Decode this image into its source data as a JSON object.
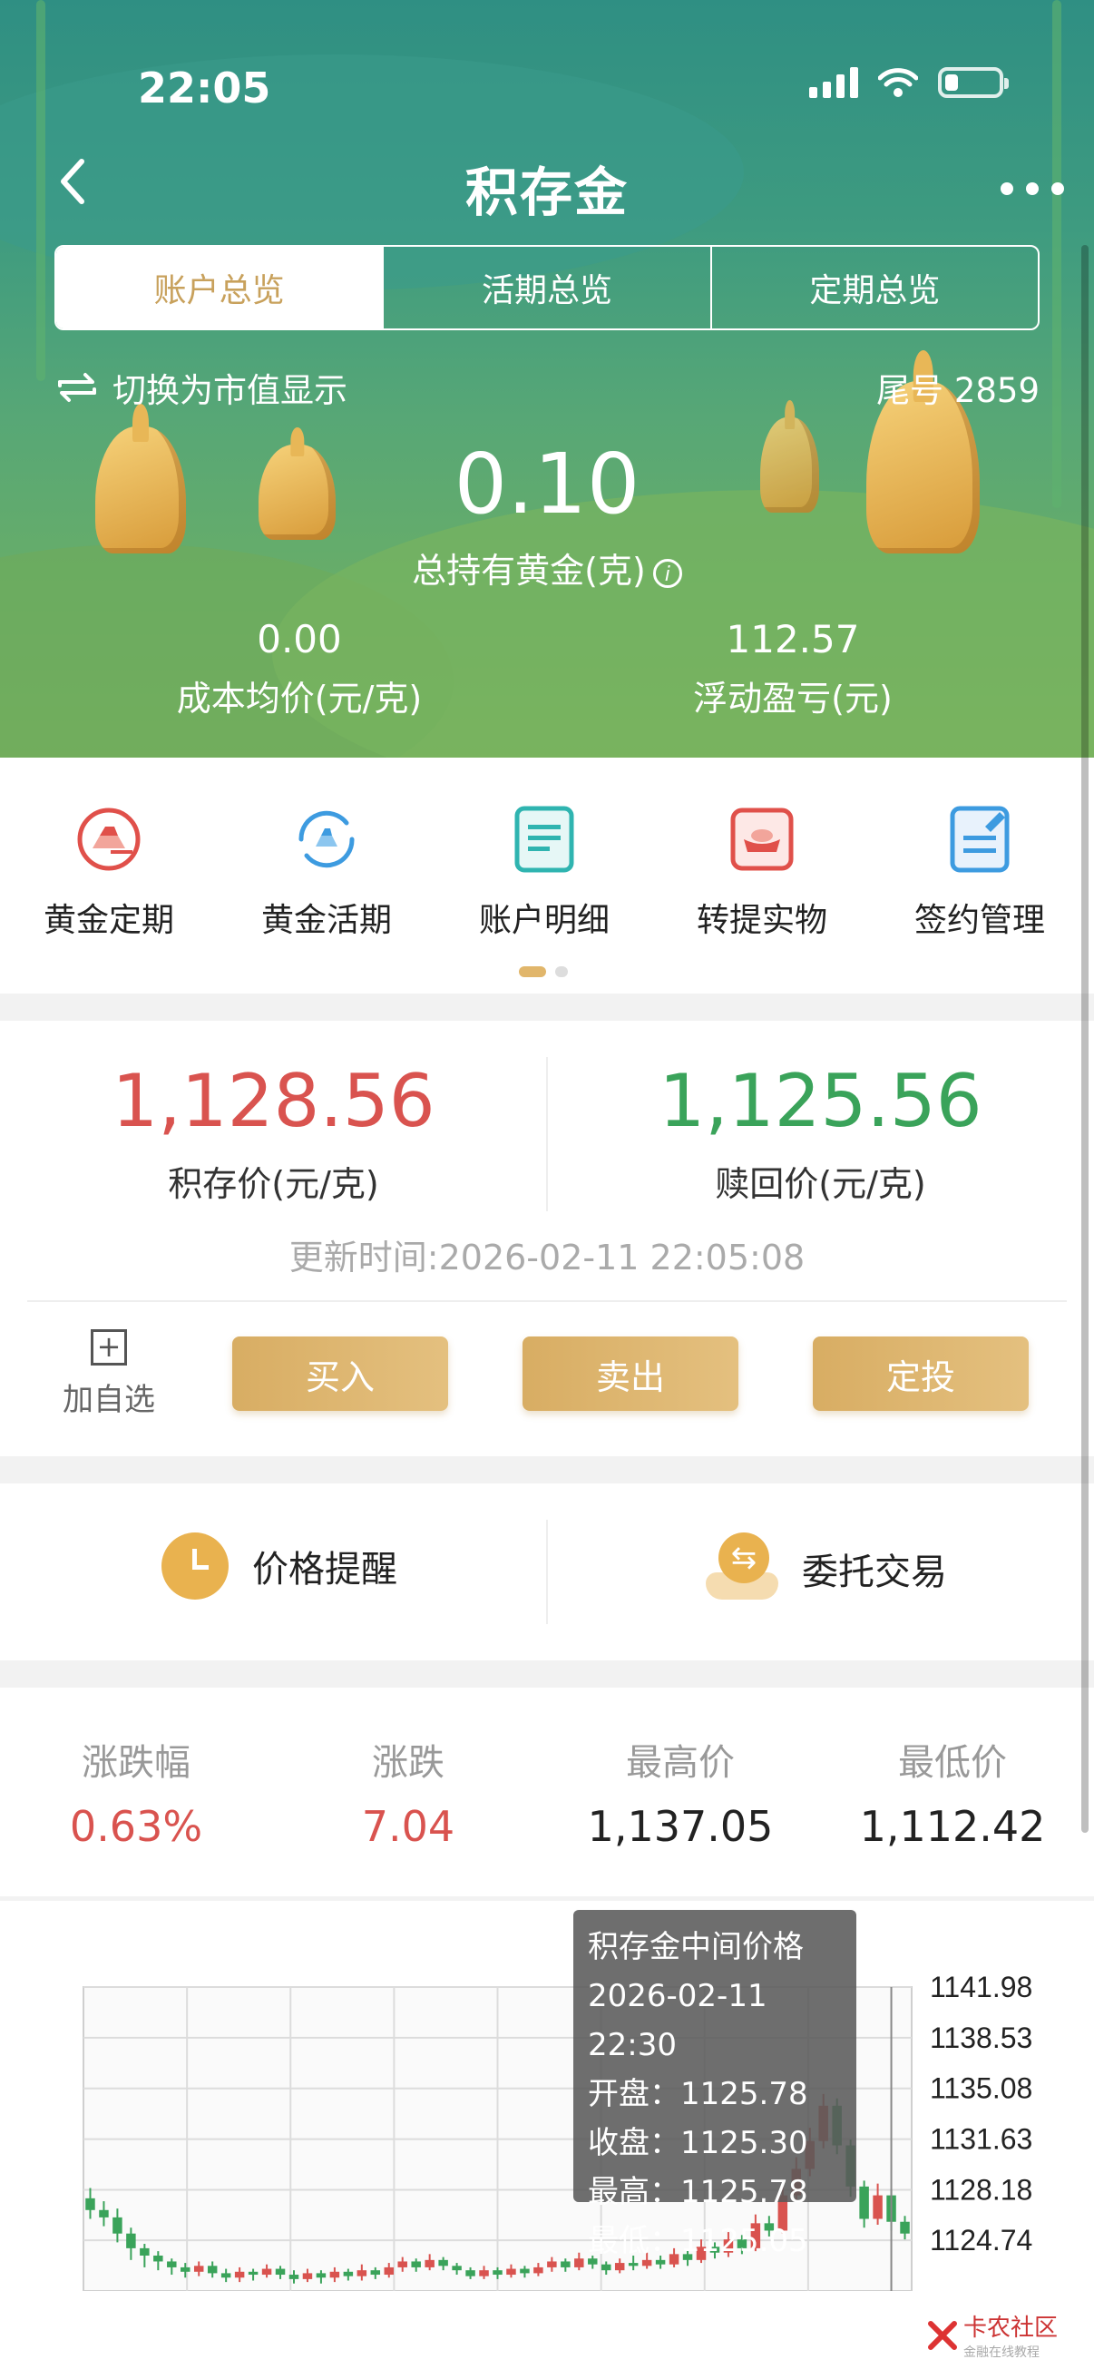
{
  "status": {
    "time": "22:05"
  },
  "nav": {
    "title": "积存金"
  },
  "tabs": [
    {
      "label": "账户总览",
      "active": true
    },
    {
      "label": "活期总览",
      "active": false
    },
    {
      "label": "定期总览",
      "active": false
    }
  ],
  "account": {
    "switch_label": "切换为市值显示",
    "tail_number": "尾号 2859",
    "total_gold": "0.10",
    "total_gold_label": "总持有黄金(克)",
    "avg_cost": "0.00",
    "avg_cost_label": "成本均价(元/克)",
    "float_pl": "112.57",
    "float_pl_label": "浮动盈亏(元)"
  },
  "quick_actions": [
    {
      "label": "黄金定期",
      "icon": "gold-bars-icon"
    },
    {
      "label": "黄金活期",
      "icon": "gold-refresh-icon"
    },
    {
      "label": "账户明细",
      "icon": "document-icon"
    },
    {
      "label": "转提实物",
      "icon": "ingot-icon"
    },
    {
      "label": "签约管理",
      "icon": "edit-document-icon"
    }
  ],
  "price": {
    "buy_price": "1,128.56",
    "buy_label": "积存价(元/克)",
    "redeem_price": "1,125.56",
    "redeem_label": "赎回价(元/克)",
    "update_time": "更新时间:2026-02-11 22:05:08",
    "add_fav": "加自选",
    "buy_btn": "买入",
    "sell_btn": "卖出",
    "plan_btn": "定投"
  },
  "tools": {
    "reminder": "价格提醒",
    "entrust": "委托交易"
  },
  "stats": [
    {
      "label": "涨跌幅",
      "value": "0.63%",
      "color": "#d9534f"
    },
    {
      "label": "涨跌",
      "value": "7.04",
      "color": "#d9534f"
    },
    {
      "label": "最高价",
      "value": "1,137.05",
      "color": "#222222"
    },
    {
      "label": "最低价",
      "value": "1,112.42",
      "color": "#222222"
    }
  ],
  "tooltip": {
    "title": "积存金中间价格",
    "time": "2026-02-11 22:30",
    "open": "开盘：1125.78",
    "close": "收盘：1125.30",
    "high": "最高：1125.78",
    "low": "最低：1125.05"
  },
  "watermark": {
    "text": "卡农社区",
    "sub": "金融在线教程"
  },
  "colors": {
    "up": "#d9534f",
    "down": "#3aa35a",
    "gold": "#d8ad63"
  },
  "chart_data": {
    "type": "candlestick",
    "y_ticks": [
      "1141.98",
      "1138.53",
      "1135.08",
      "1131.63",
      "1128.18",
      "1124.74"
    ],
    "ylim": [
      1121.29,
      1141.98
    ],
    "grid": true,
    "candles": [
      {
        "o": 1127.6,
        "c": 1126.8,
        "h": 1128.3,
        "l": 1126.2
      },
      {
        "o": 1126.8,
        "c": 1126.3,
        "h": 1127.4,
        "l": 1125.7
      },
      {
        "o": 1126.3,
        "c": 1125.2,
        "h": 1126.9,
        "l": 1124.6
      },
      {
        "o": 1125.2,
        "c": 1124.2,
        "h": 1125.6,
        "l": 1123.4
      },
      {
        "o": 1124.2,
        "c": 1123.7,
        "h": 1124.5,
        "l": 1122.9
      },
      {
        "o": 1123.7,
        "c": 1123.3,
        "h": 1124.0,
        "l": 1122.7
      },
      {
        "o": 1123.3,
        "c": 1122.9,
        "h": 1123.5,
        "l": 1122.4
      },
      {
        "o": 1122.9,
        "c": 1122.6,
        "h": 1123.2,
        "l": 1122.2
      },
      {
        "o": 1122.6,
        "c": 1123.0,
        "h": 1123.3,
        "l": 1122.3
      },
      {
        "o": 1123.0,
        "c": 1122.5,
        "h": 1123.3,
        "l": 1122.2
      },
      {
        "o": 1122.5,
        "c": 1122.2,
        "h": 1122.8,
        "l": 1121.9
      },
      {
        "o": 1122.2,
        "c": 1122.6,
        "h": 1122.9,
        "l": 1121.9
      },
      {
        "o": 1122.6,
        "c": 1122.4,
        "h": 1122.8,
        "l": 1122.0
      },
      {
        "o": 1122.4,
        "c": 1122.8,
        "h": 1123.1,
        "l": 1122.2
      },
      {
        "o": 1122.8,
        "c": 1122.4,
        "h": 1123.0,
        "l": 1122.1
      },
      {
        "o": 1122.4,
        "c": 1122.1,
        "h": 1122.7,
        "l": 1121.8
      },
      {
        "o": 1122.1,
        "c": 1122.5,
        "h": 1122.8,
        "l": 1121.9
      },
      {
        "o": 1122.5,
        "c": 1122.2,
        "h": 1122.7,
        "l": 1121.8
      },
      {
        "o": 1122.2,
        "c": 1122.6,
        "h": 1122.9,
        "l": 1121.9
      },
      {
        "o": 1122.6,
        "c": 1122.3,
        "h": 1122.8,
        "l": 1122.0
      },
      {
        "o": 1122.3,
        "c": 1122.7,
        "h": 1123.1,
        "l": 1122.0
      },
      {
        "o": 1122.7,
        "c": 1122.4,
        "h": 1122.9,
        "l": 1122.1
      },
      {
        "o": 1122.4,
        "c": 1122.9,
        "h": 1123.2,
        "l": 1122.2
      },
      {
        "o": 1122.9,
        "c": 1123.3,
        "h": 1123.6,
        "l": 1122.6
      },
      {
        "o": 1123.3,
        "c": 1122.9,
        "h": 1123.5,
        "l": 1122.6
      },
      {
        "o": 1122.9,
        "c": 1123.4,
        "h": 1123.8,
        "l": 1122.7
      },
      {
        "o": 1123.4,
        "c": 1123.0,
        "h": 1123.6,
        "l": 1122.7
      },
      {
        "o": 1123.0,
        "c": 1122.7,
        "h": 1123.2,
        "l": 1122.4
      },
      {
        "o": 1122.7,
        "c": 1122.3,
        "h": 1122.9,
        "l": 1122.1
      },
      {
        "o": 1122.3,
        "c": 1122.7,
        "h": 1123.0,
        "l": 1122.1
      },
      {
        "o": 1122.7,
        "c": 1122.4,
        "h": 1122.9,
        "l": 1122.1
      },
      {
        "o": 1122.4,
        "c": 1122.8,
        "h": 1123.1,
        "l": 1122.2
      },
      {
        "o": 1122.8,
        "c": 1122.5,
        "h": 1123.0,
        "l": 1122.2
      },
      {
        "o": 1122.5,
        "c": 1122.9,
        "h": 1123.2,
        "l": 1122.3
      },
      {
        "o": 1122.9,
        "c": 1123.3,
        "h": 1123.6,
        "l": 1122.6
      },
      {
        "o": 1123.3,
        "c": 1122.9,
        "h": 1123.5,
        "l": 1122.6
      },
      {
        "o": 1122.9,
        "c": 1123.5,
        "h": 1123.9,
        "l": 1122.7
      },
      {
        "o": 1123.5,
        "c": 1123.1,
        "h": 1123.7,
        "l": 1122.8
      },
      {
        "o": 1123.1,
        "c": 1122.7,
        "h": 1123.3,
        "l": 1122.4
      },
      {
        "o": 1122.7,
        "c": 1123.2,
        "h": 1123.5,
        "l": 1122.5
      },
      {
        "o": 1123.2,
        "c": 1123.0,
        "h": 1123.7,
        "l": 1122.7
      },
      {
        "o": 1123.0,
        "c": 1123.4,
        "h": 1123.9,
        "l": 1122.8
      },
      {
        "o": 1123.4,
        "c": 1123.1,
        "h": 1123.7,
        "l": 1122.8
      },
      {
        "o": 1123.1,
        "c": 1123.8,
        "h": 1124.2,
        "l": 1122.9
      },
      {
        "o": 1123.8,
        "c": 1123.4,
        "h": 1124.1,
        "l": 1123.0
      },
      {
        "o": 1123.4,
        "c": 1124.3,
        "h": 1124.8,
        "l": 1123.2
      },
      {
        "o": 1124.3,
        "c": 1123.9,
        "h": 1124.6,
        "l": 1123.5
      },
      {
        "o": 1123.9,
        "c": 1124.8,
        "h": 1125.3,
        "l": 1123.6
      },
      {
        "o": 1124.8,
        "c": 1124.2,
        "h": 1125.1,
        "l": 1123.8
      },
      {
        "o": 1124.2,
        "c": 1125.9,
        "h": 1126.5,
        "l": 1124.0
      },
      {
        "o": 1125.9,
        "c": 1125.4,
        "h": 1126.4,
        "l": 1125.0
      },
      {
        "o": 1125.4,
        "c": 1127.8,
        "h": 1128.4,
        "l": 1125.2
      },
      {
        "o": 1127.8,
        "c": 1129.6,
        "h": 1130.4,
        "l": 1127.4
      },
      {
        "o": 1129.6,
        "c": 1131.5,
        "h": 1132.4,
        "l": 1129.1
      },
      {
        "o": 1131.5,
        "c": 1133.9,
        "h": 1134.7,
        "l": 1131.0
      },
      {
        "o": 1133.9,
        "c": 1131.2,
        "h": 1134.4,
        "l": 1130.6
      },
      {
        "o": 1131.2,
        "c": 1128.4,
        "h": 1131.6,
        "l": 1127.7
      },
      {
        "o": 1128.4,
        "c": 1126.2,
        "h": 1128.8,
        "l": 1125.6
      },
      {
        "o": 1126.2,
        "c": 1127.8,
        "h": 1128.6,
        "l": 1125.8
      },
      {
        "o": 1127.8,
        "c": 1126.0,
        "h": 1128.2,
        "l": 1125.4
      },
      {
        "o": 1126.0,
        "c": 1125.2,
        "h": 1126.4,
        "l": 1124.8
      }
    ]
  }
}
